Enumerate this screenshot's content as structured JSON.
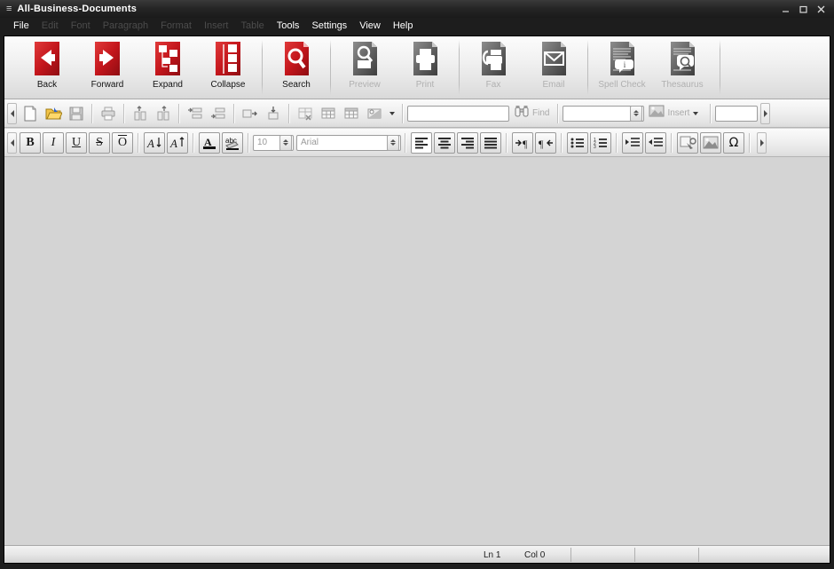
{
  "window": {
    "title": "All-Business-Documents",
    "sysmenu_icon": "system-menu-icon",
    "buttons": {
      "minimize": "minimize-icon",
      "maximize": "maximize-icon",
      "close": "close-icon"
    }
  },
  "menubar": {
    "items": [
      {
        "label": "File",
        "enabled": true
      },
      {
        "label": "Edit",
        "enabled": false
      },
      {
        "label": "Font",
        "enabled": false
      },
      {
        "label": "Paragraph",
        "enabled": false
      },
      {
        "label": "Format",
        "enabled": false
      },
      {
        "label": "Insert",
        "enabled": false
      },
      {
        "label": "Table",
        "enabled": false
      },
      {
        "label": "Tools",
        "enabled": true
      },
      {
        "label": "Settings",
        "enabled": true
      },
      {
        "label": "View",
        "enabled": true
      },
      {
        "label": "Help",
        "enabled": true
      }
    ]
  },
  "main_toolbar": {
    "accent_color": "#c4161c",
    "disabled_color": "#6f6f6f",
    "buttons": [
      {
        "label": "Back",
        "icon": "back-arrow-icon",
        "enabled": true
      },
      {
        "label": "Forward",
        "icon": "forward-arrow-icon",
        "enabled": true
      },
      {
        "label": "Expand",
        "icon": "expand-tree-icon",
        "enabled": true
      },
      {
        "label": "Collapse",
        "icon": "collapse-tree-icon",
        "enabled": true
      },
      {
        "label": "Search",
        "icon": "search-magnifier-icon",
        "enabled": true
      },
      {
        "label": "Preview",
        "icon": "print-preview-icon",
        "enabled": false
      },
      {
        "label": "Print",
        "icon": "printer-icon",
        "enabled": false
      },
      {
        "label": "Fax",
        "icon": "fax-icon",
        "enabled": false
      },
      {
        "label": "Email",
        "icon": "envelope-icon",
        "enabled": false
      },
      {
        "label": "Spell Check",
        "icon": "spell-check-icon",
        "enabled": false
      },
      {
        "label": "Thesaurus",
        "icon": "thesaurus-icon",
        "enabled": false
      }
    ]
  },
  "standard_toolbar": {
    "buttons": [
      {
        "name": "new-document-button",
        "icon": "blank-page-icon",
        "enabled": true
      },
      {
        "name": "open-document-button",
        "icon": "open-folder-icon",
        "enabled": true
      },
      {
        "name": "save-document-button",
        "icon": "floppy-disk-icon",
        "enabled": false
      },
      {
        "name": "print-button",
        "icon": "printer-icon",
        "enabled": false
      },
      {
        "name": "insert-column-left-button",
        "icon": "insert-column-left-icon",
        "enabled": false
      },
      {
        "name": "insert-column-right-button",
        "icon": "insert-column-right-icon",
        "enabled": false
      },
      {
        "name": "insert-row-above-button",
        "icon": "insert-row-above-icon",
        "enabled": false
      },
      {
        "name": "insert-row-below-button",
        "icon": "insert-row-below-icon",
        "enabled": false
      },
      {
        "name": "merge-cells-button",
        "icon": "merge-cells-icon",
        "enabled": false
      },
      {
        "name": "split-cells-button",
        "icon": "split-cells-icon",
        "enabled": false
      },
      {
        "name": "delete-table-button",
        "icon": "delete-table-icon",
        "enabled": false
      },
      {
        "name": "table-properties-button",
        "icon": "table-grid-icon",
        "enabled": false
      },
      {
        "name": "insert-table-button",
        "icon": "table-insert-icon",
        "enabled": false
      },
      {
        "name": "table-style-button",
        "icon": "table-style-icon",
        "enabled": false
      }
    ],
    "find_input": {
      "value": "",
      "placeholder": ""
    },
    "find_button": {
      "label": "Find",
      "icon": "binoculars-icon",
      "enabled": false
    },
    "goto_combo": {
      "value": "",
      "enabled": false
    },
    "insert_button": {
      "label": "Insert",
      "icon": "insert-object-icon",
      "enabled": false
    },
    "zoom_combo": {
      "value": "",
      "enabled": false
    }
  },
  "format_toolbar": {
    "buttons": [
      {
        "name": "bold-button",
        "glyph": "B",
        "enabled": true
      },
      {
        "name": "italic-button",
        "glyph": "I",
        "enabled": true
      },
      {
        "name": "underline-button",
        "glyph": "U",
        "enabled": true
      },
      {
        "name": "strikethrough-button",
        "glyph": "S",
        "enabled": true
      },
      {
        "name": "overline-button",
        "glyph": "O",
        "enabled": true
      },
      {
        "name": "decrease-font-size-button",
        "glyph": "A",
        "enabled": true
      },
      {
        "name": "increase-font-size-button",
        "glyph": "A",
        "enabled": true
      },
      {
        "name": "font-color-button",
        "glyph": "A",
        "enabled": true
      },
      {
        "name": "highlight-color-button",
        "glyph": "abc",
        "enabled": true
      }
    ],
    "font_size": {
      "value": "10",
      "enabled": false
    },
    "font_name": {
      "value": "Arial",
      "enabled": false
    },
    "align_buttons": [
      {
        "name": "align-left-button",
        "icon": "align-left-icon",
        "selected": true
      },
      {
        "name": "align-center-button",
        "icon": "align-center-icon",
        "selected": false
      },
      {
        "name": "align-right-button",
        "icon": "align-right-icon",
        "selected": false
      },
      {
        "name": "align-justify-button",
        "icon": "align-justify-icon",
        "selected": false
      }
    ],
    "direction_buttons": [
      {
        "name": "ltr-paragraph-button",
        "icon": "pilcrow-ltr-icon"
      },
      {
        "name": "rtl-paragraph-button",
        "icon": "pilcrow-rtl-icon"
      }
    ],
    "list_buttons": [
      {
        "name": "bullet-list-button",
        "icon": "bullet-list-icon"
      },
      {
        "name": "numbered-list-button",
        "icon": "numbered-list-icon"
      },
      {
        "name": "decrease-indent-button",
        "icon": "decrease-indent-icon"
      },
      {
        "name": "increase-indent-button",
        "icon": "increase-indent-icon"
      }
    ],
    "insert_buttons": [
      {
        "name": "insert-hyperlink-button",
        "icon": "hyperlink-icon"
      },
      {
        "name": "insert-image-button",
        "icon": "picture-icon"
      },
      {
        "name": "insert-symbol-button",
        "icon": "omega-icon",
        "glyph": "Ω"
      }
    ],
    "overflow_button": {
      "name": "toolbar-overflow-button",
      "icon": "chevron-right-icon"
    }
  },
  "statusbar": {
    "line": "Ln 1",
    "column": "Col 0",
    "cells": [
      "",
      "",
      ""
    ]
  }
}
